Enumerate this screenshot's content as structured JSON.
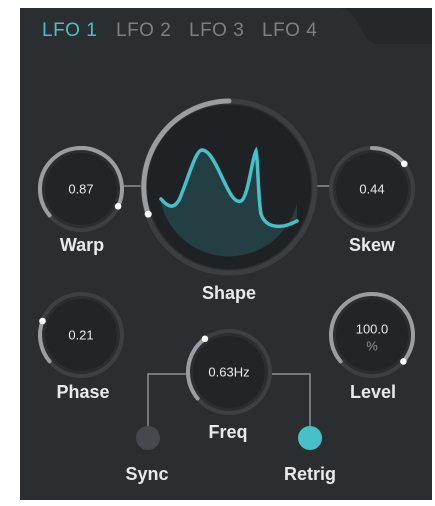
{
  "tabs": [
    {
      "label": "LFO 1",
      "active": true
    },
    {
      "label": "LFO 2",
      "active": false
    },
    {
      "label": "LFO 3",
      "active": false
    },
    {
      "label": "LFO 4",
      "active": false
    }
  ],
  "knobs": {
    "warp": {
      "label": "Warp",
      "value": "0.87"
    },
    "skew": {
      "label": "Skew",
      "value": "0.44"
    },
    "phase": {
      "label": "Phase",
      "value": "0.21"
    },
    "level": {
      "label": "Level",
      "value": "100.0",
      "unit": "%"
    },
    "freq": {
      "label": "Freq",
      "value": "0.63Hz"
    }
  },
  "shape": {
    "label": "Shape"
  },
  "toggles": {
    "sync": {
      "label": "Sync",
      "on": false
    },
    "retrig": {
      "label": "Retrig",
      "on": true
    }
  },
  "colors": {
    "accent": "#47c0c9",
    "panel": "#2b2e31",
    "knob": "#222528",
    "ring": "#9a9ea2"
  }
}
